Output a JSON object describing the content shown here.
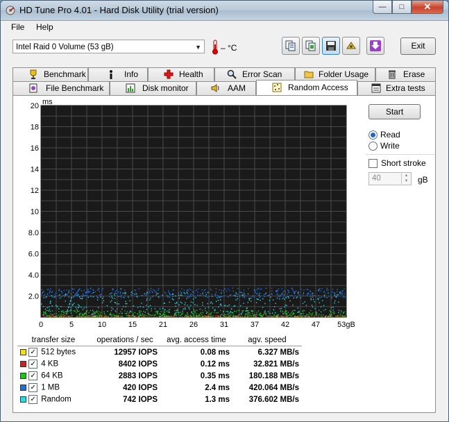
{
  "window": {
    "title": "HD Tune Pro 4.01 - Hard Disk Utility (trial version)",
    "minimize": "—",
    "maximize": "□",
    "close": "✕"
  },
  "menu": {
    "file": "File",
    "help": "Help"
  },
  "toolbar": {
    "drive": "Intel   Raid 0 Volume (53 gB)",
    "temperature": "– °C",
    "exit": "Exit",
    "icons": [
      "copy-info-icon",
      "copy-screenshot-icon",
      "save-icon",
      "options-icon",
      "download-icon"
    ]
  },
  "tabs_row1": [
    {
      "label": "Benchmark",
      "icon": "trophy-icon"
    },
    {
      "label": "Info",
      "icon": "info-icon"
    },
    {
      "label": "Health",
      "icon": "health-cross-icon"
    },
    {
      "label": "Error Scan",
      "icon": "magnifier-icon"
    },
    {
      "label": "Folder Usage",
      "icon": "folder-icon"
    },
    {
      "label": "Erase",
      "icon": "trash-icon"
    }
  ],
  "tabs_row2": [
    {
      "label": "File Benchmark",
      "icon": "file-benchmark-icon"
    },
    {
      "label": "Disk monitor",
      "icon": "chart-icon"
    },
    {
      "label": "AAM",
      "icon": "speaker-icon"
    },
    {
      "label": "Random Access",
      "icon": "random-access-icon",
      "active": true
    },
    {
      "label": "Extra tests",
      "icon": "extra-tests-icon"
    }
  ],
  "controls": {
    "start": "Start",
    "read": "Read",
    "write": "Write",
    "short_stroke": "Short stroke",
    "stroke_value": "40",
    "stroke_unit": "gB",
    "read_selected": true,
    "short_stroke_checked": false
  },
  "chart_data": {
    "type": "scatter",
    "ylabel": "ms",
    "ylim": [
      0,
      20
    ],
    "y_ticks": [
      "20",
      "18",
      "16",
      "14",
      "12",
      "10",
      "8.0",
      "6.0",
      "4.0",
      "2.0"
    ],
    "x_ticks": [
      "0",
      "5",
      "10",
      "15",
      "21",
      "26",
      "31",
      "37",
      "42",
      "47",
      "53gB"
    ],
    "xlim": [
      0,
      53
    ],
    "xunit": "gB",
    "series": [
      {
        "name": "512 bytes",
        "color": "#f0e020",
        "band": [
          0.03,
          0.12
        ]
      },
      {
        "name": "4 KB",
        "color": "#d02020",
        "band": [
          0.05,
          0.2
        ]
      },
      {
        "name": "64 KB",
        "color": "#20c020",
        "band": [
          0.1,
          0.7
        ]
      },
      {
        "name": "1 MB",
        "color": "#2070e0",
        "band": [
          1.9,
          2.8
        ]
      },
      {
        "name": "Random",
        "color": "#30d8e0",
        "band": [
          0.3,
          2.4
        ]
      }
    ],
    "grid": true,
    "background": "#1a1a1a"
  },
  "results": {
    "headers": [
      "transfer size",
      "operations / sec",
      "avg. access time",
      "agv. speed"
    ],
    "rows": [
      {
        "color": "#f0e020",
        "size": "512 bytes",
        "ops": "12957 IOPS",
        "access": "0.08 ms",
        "speed": "6.327 MB/s"
      },
      {
        "color": "#d02020",
        "size": "4 KB",
        "ops": "8402 IOPS",
        "access": "0.12 ms",
        "speed": "32.821 MB/s"
      },
      {
        "color": "#20c020",
        "size": "64 KB",
        "ops": "2883 IOPS",
        "access": "0.35 ms",
        "speed": "180.188 MB/s"
      },
      {
        "color": "#2070e0",
        "size": "1 MB",
        "ops": "420 IOPS",
        "access": "2.4 ms",
        "speed": "420.064 MB/s"
      },
      {
        "color": "#30d8e0",
        "size": "Random",
        "ops": "742 IOPS",
        "access": "1.3 ms",
        "speed": "376.602 MB/s"
      }
    ]
  }
}
